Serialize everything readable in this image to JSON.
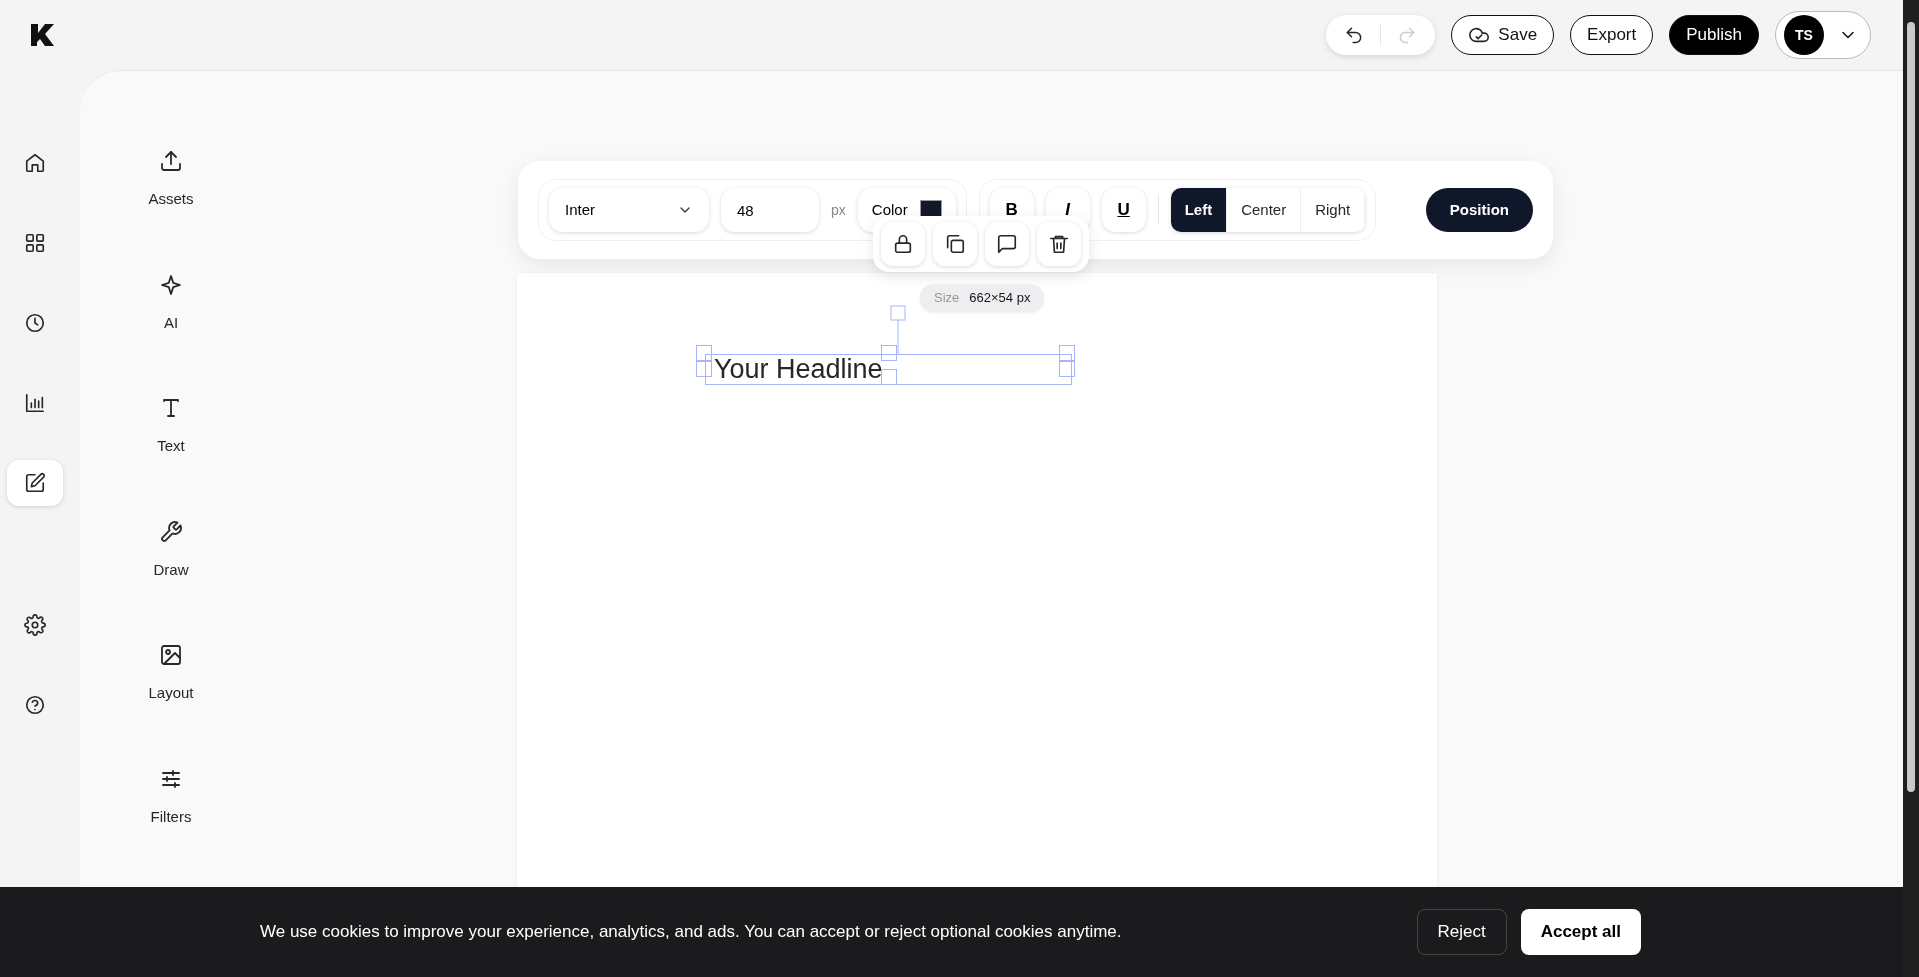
{
  "history": {
    "undo": {
      "disabled": false
    },
    "redo": {
      "disabled": true
    }
  },
  "header": {
    "save": "Save",
    "export": "Export",
    "publish": "Publish",
    "initials": "TS"
  },
  "rail": [
    {
      "selected": false
    },
    {
      "selected": false
    },
    {
      "selected": false
    },
    {
      "selected": false
    },
    {
      "selected": true
    },
    {
      "selected": false
    },
    {
      "selected": false
    }
  ],
  "tools": [
    {
      "label": "Assets"
    },
    {
      "label": "AI"
    },
    {
      "label": "Text"
    },
    {
      "label": "Draw"
    },
    {
      "label": "Layout"
    },
    {
      "label": "Filters"
    }
  ],
  "toolbar": {
    "font": "Inter",
    "size": "48",
    "unit": "px",
    "color_label": "Color",
    "color": "#111827",
    "format": [
      {
        "label": "B",
        "kind": "bold"
      },
      {
        "label": "I",
        "kind": "italic"
      },
      {
        "label": "U",
        "kind": "underline"
      }
    ],
    "align": [
      {
        "label": "Left",
        "selected": true
      },
      {
        "label": "Center",
        "selected": false
      },
      {
        "label": "Right",
        "selected": false
      }
    ],
    "position": "Position"
  },
  "size_tag": {
    "label": "Size",
    "value": "662×54 px"
  },
  "canvas": {
    "headline": "Your Headline"
  },
  "cookie_banner": {
    "message": "We use cookies to improve your experience, analytics, and ads. You can accept or reject optional cookies anytime.",
    "reject": "Reject",
    "accept": "Accept all"
  }
}
